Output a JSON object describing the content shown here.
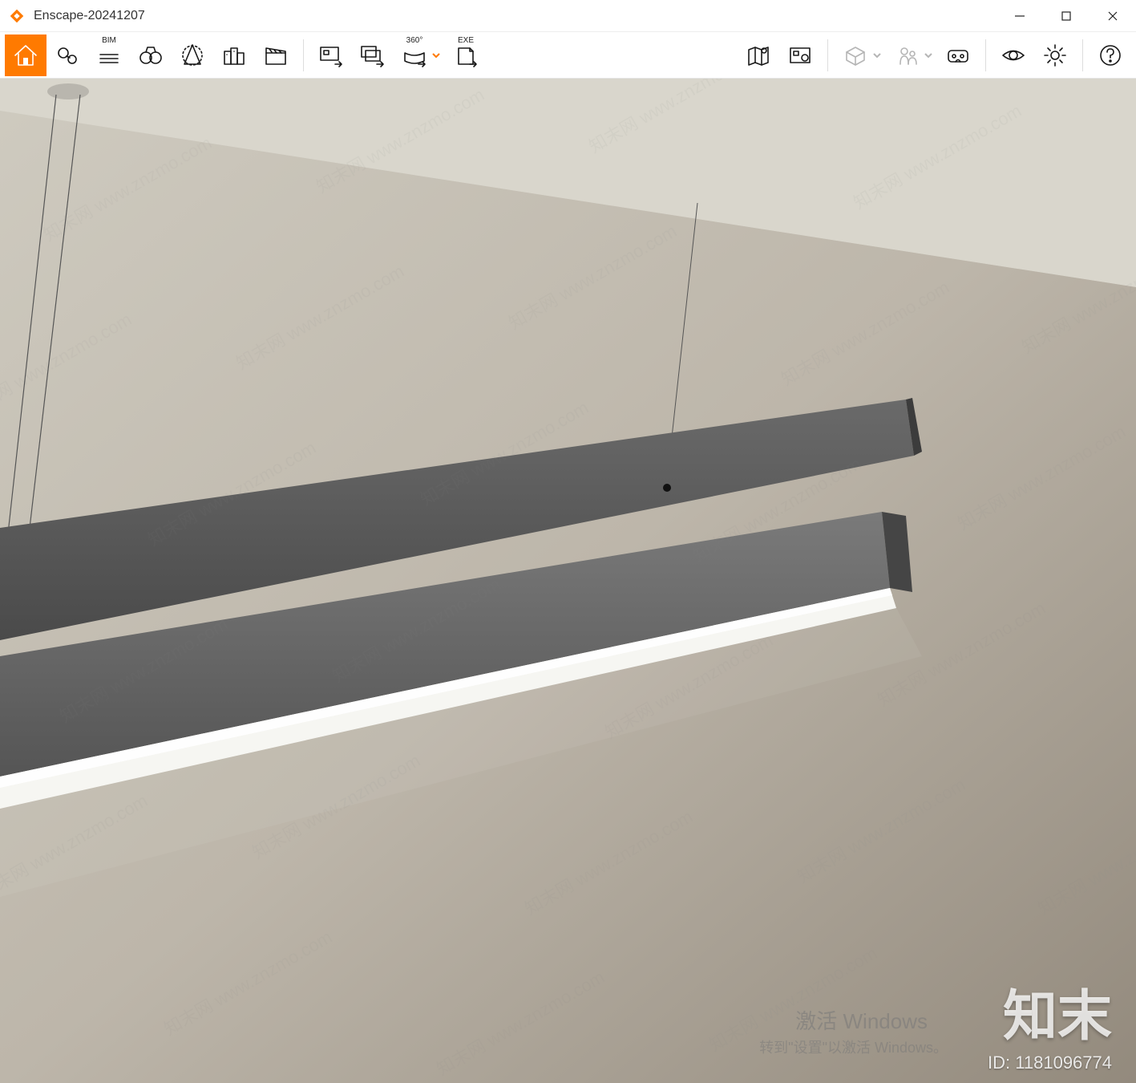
{
  "window": {
    "app_name": "Enscape",
    "title_sep": " - ",
    "document": "20241207"
  },
  "toolbar": {
    "bim_label": "BIM",
    "pano_label": "360°",
    "exe_label": "EXE"
  },
  "overlay": {
    "activate_windows_title": "激活 Windows",
    "activate_windows_sub": "转到\"设置\"以激活 Windows。",
    "brand_watermark": "知末",
    "id_label": "ID: 1181096774",
    "site_watermark": "知末网 www.znzmo.com"
  }
}
